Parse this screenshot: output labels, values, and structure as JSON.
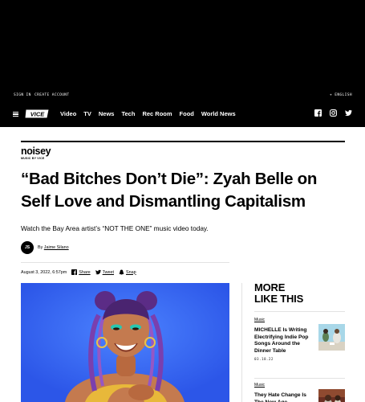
{
  "topbar": {
    "sign_in": "SIGN IN",
    "create_account": "CREATE ACCOUNT",
    "language": "+ ENGLISH"
  },
  "nav": {
    "logo": "VICE",
    "links": [
      "Video",
      "TV",
      "News",
      "Tech",
      "Rec Room",
      "Food",
      "World News"
    ],
    "social_icons": [
      "facebook-icon",
      "instagram-icon",
      "twitter-icon"
    ]
  },
  "brand": {
    "wordmark": "noisey",
    "subline": "MUSIC BY VICE"
  },
  "article": {
    "title": "“Bad Bitches Don’t Die”: Zyah Belle on Self Love and Dismantling Capitalism",
    "dek": "Watch the Bay Area artist’s “NOT THE ONE” music video today.",
    "author_initials": "JS",
    "by_prefix": "By",
    "author": "Jaime Silano",
    "date": "August 3, 2022, 6:57pm",
    "share": [
      {
        "icon": "facebook-icon",
        "label": "Share"
      },
      {
        "icon": "twitter-icon",
        "label": "Tweet"
      },
      {
        "icon": "snapchat-icon",
        "label": "Snap"
      }
    ]
  },
  "sidebar": {
    "heading_line1": "MORE",
    "heading_line2": "LIKE THIS",
    "cards": [
      {
        "category": "Music",
        "title": "MICHELLE Is Writing Electrifying Indie Pop Songs Around the Dinner Table",
        "date": "03.18.22"
      },
      {
        "category": "Music",
        "title": "They Hate Change Is The New Age",
        "date": ""
      }
    ]
  },
  "colors": {
    "hero_bg": "#3366f0",
    "black": "#000000"
  }
}
